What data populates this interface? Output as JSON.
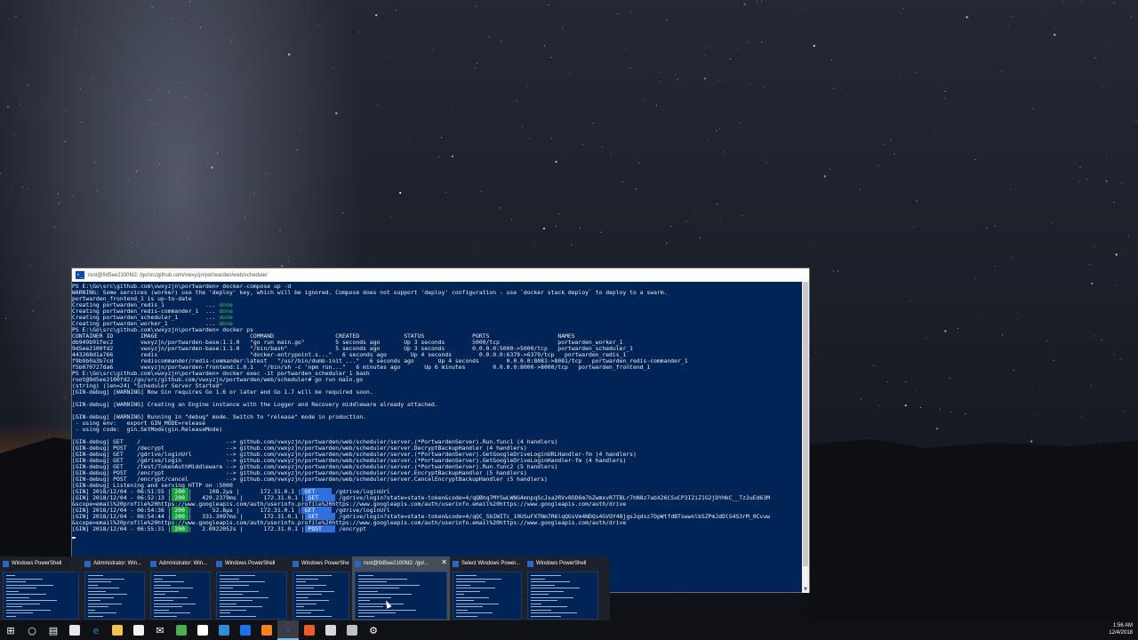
{
  "console": {
    "title": "root@9d5ee2100fd2: /go/src/github.com/vwxyzjn/portwarden/web/scheduler",
    "lines": [
      {
        "t": "PS E:\\Go\\src\\github.com\\vwxyzjn\\portwarden> docker-compose up -d"
      },
      {
        "t": "WARNING: Some services (worker) use the 'deploy' key, which will be ignored. Compose does not support 'deploy' configuration - use `docker stack deploy` to deploy to a swarm."
      },
      {
        "t": "portwarden_frontend_1 is up-to-date"
      },
      {
        "t": "Creating portwarden_redis_1            ... ",
        "s": "done"
      },
      {
        "t": "Creating portwarden_redis-commander_1  ... ",
        "s": "done"
      },
      {
        "t": "Creating portwarden_scheduler_1        ... ",
        "s": "done"
      },
      {
        "t": "Creating portwarden_worker_1           ... ",
        "s": "done"
      },
      {
        "t": "PS E:\\Go\\src\\github.com\\vwxyzjn\\portwarden> docker ps"
      },
      {
        "t": "CONTAINER ID        IMAGE                           COMMAND                  CREATED             STATUS              PORTS                    NAMES"
      },
      {
        "t": "db949b91fec2        vwxyzjn/portwarden-base:1.1.0   \"go run main.go\"         5 seconds ago       Up 3 seconds        5000/tcp                 portwarden_worker_1"
      },
      {
        "t": "9d5ee2100fd2        vwxyzjn/portwarden-base:1.1.0   \"/bin/bash\"              5 seconds ago       Up 3 seconds        0.0.0.0:5000->5000/tcp   portwarden_scheduler_1"
      },
      {
        "t": "443268d1a766        redis                           \"docker-entrypoint.s...\"   6 seconds ago       Up 4 seconds        0.0.0.0:6379->6379/tcp   portwarden_redis_1"
      },
      {
        "t": "f9b9b0a3b7cd        rediscommander/redis-commander:latest   \"/usr/bin/dumb-init ...\"   6 seconds ago       Up 4 seconds        0.0.0.0:8081->8081/tcp   portwarden_redis-commander_1"
      },
      {
        "t": "f5b070727da6        vwxyzjn/portwarden-frontend:1.0.1   \"/bin/sh -c 'npm run...\"   6 minutes ago       Up 6 minutes        0.0.0.0:8000->8000/tcp   portwarden_frontend_1"
      },
      {
        "t": "PS E:\\Go\\src\\github.com\\vwxyzjn\\portwarden> docker exec -it portwarden_scheduler_1 bash"
      },
      {
        "t": "root@9d5ee2100fd2:/go/src/github.com/vwxyzjn/portwarden/web/scheduler# go run main.go"
      },
      {
        "t": "(string) (len=24) \"Scheduler Server Started\""
      },
      {
        "t": "[GIN-debug] [WARNING] Now Gin requires Go 1.6 or later and Go 1.7 will be required soon."
      },
      {
        "t": ""
      },
      {
        "t": "[GIN-debug] [WARNING] Creating an Engine instance with the Logger and Recovery middleware already attached."
      },
      {
        "t": ""
      },
      {
        "t": "[GIN-debug] [WARNING] Running in \"debug\" mode. Switch to \"release\" mode in production."
      },
      {
        "t": " - using env:   export GIN_MODE=release"
      },
      {
        "t": " - using code:  gin.SetMode(gin.ReleaseMode)"
      },
      {
        "t": ""
      },
      {
        "t": "[GIN-debug] GET    /                         --> github.com/vwxyzjn/portwarden/web/scheduler/server.(*PortwardenServer).Run.func1 (4 handlers)"
      },
      {
        "t": "[GIN-debug] POST   /decrypt                  --> github.com/vwxyzjn/portwarden/web/scheduler/server.DecryptBackupHandler (4 handlers)"
      },
      {
        "t": "[GIN-debug] GET    /gdrive/loginUrl          --> github.com/vwxyzjn/portwarden/web/scheduler/server.(*PortwardenServer).GetGoogleDriveLoginURLHandler-fm (4 handlers)"
      },
      {
        "t": "[GIN-debug] GET    /gdrive/login             --> github.com/vwxyzjn/portwarden/web/scheduler/server.(*PortwardenServer).GetGoogleDriveLoginHandler-fm (4 handlers)"
      },
      {
        "t": "[GIN-debug] GET    /test/TokenAuthMiddleware --> github.com/vwxyzjn/portwarden/web/scheduler/server.(*PortwardenServer).Run.func2 (5 handlers)"
      },
      {
        "t": "[GIN-debug] POST   /encrypt                  --> github.com/vwxyzjn/portwarden/web/scheduler/server.EncryptBackupHandler (5 handlers)"
      },
      {
        "t": "[GIN-debug] POST   /encrypt/cancel           --> github.com/vwxyzjn/portwarden/web/scheduler/server.CancelEncryptBackupHandler (5 handlers)"
      },
      {
        "t": "[GIN-debug] Listening and serving HTTP on :5000"
      },
      {
        "gin": true,
        "pre": "[GIN] 2018/12/04 - 06:51:55 |",
        "code": " 200 ",
        "mid": "|     108.2µs |      172.31.0.1 |",
        "method": " GET     ",
        "post": " /gdrive/loginUrl"
      },
      {
        "gin": true,
        "pre": "[GIN] 2018/12/04 - 06:52:13 |",
        "code": " 200 ",
        "mid": "|   429.2379ms |      172.31.0.1 |",
        "method": " GET     ",
        "post": " /gdrive/login?state=state-token&code=4/qQBhq7MYSwLWNG4mnpqScJxa2RVv8OD6m7bZwmxvR7TBLr7hN8z7abX26CSuCP3I2iZ1G2jDYHkC__Tz2uEd63M"
      },
      {
        "t": "&scope=email%20profile%20https://www.googleapis.com/auth/userinfo.profile%20https://www.googleapis.com/auth/userinfo.email%20https://www.googleapis.com/auth/drive"
      },
      {
        "gin": true,
        "pre": "[GIN] 2018/12/04 - 06:54:36 |",
        "code": " 200 ",
        "mid": "|      52.8µs |      172.31.0.1 |",
        "method": " GET     ",
        "post": " /gdrive/loginUrl"
      },
      {
        "gin": true,
        "pre": "[GIN] 2018/12/04 - 06:54:44 |",
        "code": " 200 ",
        "mid": "|   331.3097ms |      172.31.0.1 |",
        "method": " GET     ",
        "post": " /gdrive/login?state=state-token&code=4/qQC_5bIWITc_10USuFXTNm7R6lqQGsVm4NDQs4GVOY48jgsJqdsz7OpWtfdBTswwnlbSZPmJdDlS4S3rM_0Cvuw"
      },
      {
        "t": "&scope=email%20profile%20https://www.googleapis.com/auth/userinfo.profile%20https://www.googleapis.com/auth/userinfo.email%20https://www.googleapis.com/auth/drive"
      },
      {
        "gin": true,
        "pre": "[GIN] 2018/12/04 - 06:55:31 |",
        "code": " 200 ",
        "mid": "|   2.0922052s |      172.31.0.1 |",
        "method": " POST    ",
        "post": " /encrypt"
      }
    ]
  },
  "thumbnails": [
    {
      "label": "Windows PowerShell",
      "width": 92,
      "selected": false
    },
    {
      "label": "Administrator: Win...",
      "width": 74,
      "selected": false
    },
    {
      "label": "Administrator: Win...",
      "width": 74,
      "selected": false
    },
    {
      "label": "Windows PowerShell",
      "width": 86,
      "selected": false
    },
    {
      "label": "Windows PowerShell",
      "width": 70,
      "selected": false
    },
    {
      "label": "root@9d5ee2100fd2: /go/...",
      "width": 110,
      "selected": true
    },
    {
      "label": "Select Windows Power...",
      "width": 84,
      "selected": false
    },
    {
      "label": "Windows PowerShell",
      "width": 86,
      "selected": false
    }
  ],
  "taskbar": {
    "icons": [
      {
        "name": "start-button",
        "glyph": "⊞",
        "color": "#ffffff",
        "state": ""
      },
      {
        "name": "cortana-search-icon",
        "glyph": "○",
        "color": "#ffffff",
        "state": ""
      },
      {
        "name": "task-view-icon",
        "glyph": "▤",
        "color": "#ffffff",
        "state": ""
      },
      {
        "name": "app-icon-1",
        "glyph": "",
        "color": "#e8e8e8",
        "state": ""
      },
      {
        "name": "edge-browser-icon",
        "glyph": "e",
        "color": "#1e8ad6",
        "state": ""
      },
      {
        "name": "file-explorer-icon",
        "glyph": "",
        "color": "#f2c14e",
        "state": ""
      },
      {
        "name": "store-icon",
        "glyph": "",
        "color": "#f3f3f3",
        "state": ""
      },
      {
        "name": "mail-icon",
        "glyph": "✉",
        "color": "#ffffff",
        "state": ""
      },
      {
        "name": "chrome-icon",
        "glyph": "",
        "color": "#4caf50",
        "state": ""
      },
      {
        "name": "github-icon",
        "glyph": "",
        "color": "#ffffff",
        "state": ""
      },
      {
        "name": "vscode-icon",
        "glyph": "",
        "color": "#2e8fd8",
        "state": ""
      },
      {
        "name": "maps-icon",
        "glyph": "",
        "color": "#1a73e8",
        "state": ""
      },
      {
        "name": "firefox-icon",
        "glyph": "",
        "color": "#f5821f",
        "state": ""
      },
      {
        "name": "powershell-icon",
        "glyph": "›",
        "color": "#2a66c9",
        "state": "active"
      },
      {
        "name": "postman-icon",
        "glyph": "",
        "color": "#ef5b25",
        "state": ""
      },
      {
        "name": "notes-icon",
        "glyph": "",
        "color": "#d8d8d8",
        "state": ""
      },
      {
        "name": "network-icon",
        "glyph": "",
        "color": "#c0c0c0",
        "state": ""
      },
      {
        "name": "settings-icon",
        "glyph": "⚙",
        "color": "#ffffff",
        "state": ""
      }
    ],
    "time": "1:56 AM",
    "date": "12/4/2018"
  }
}
